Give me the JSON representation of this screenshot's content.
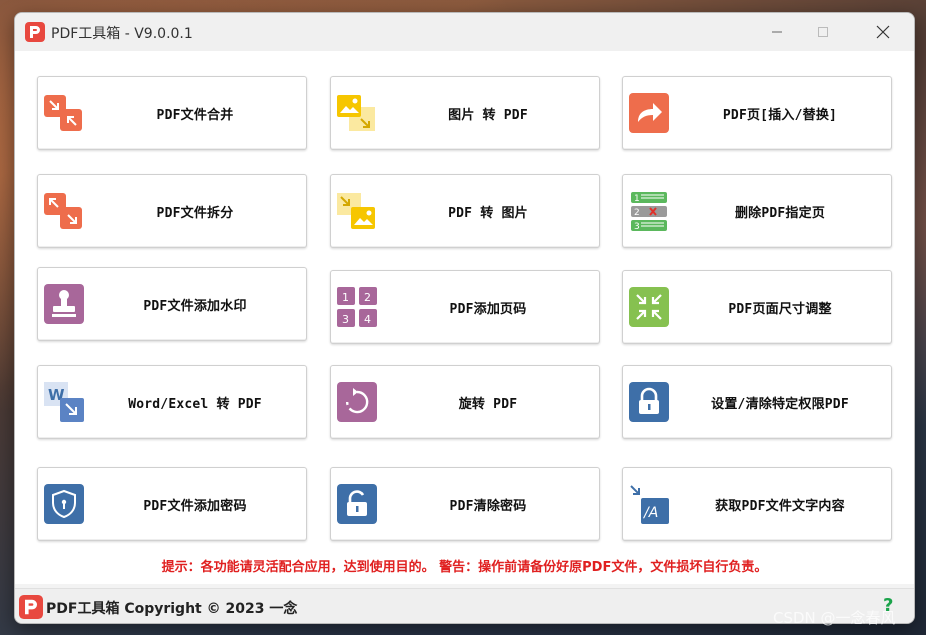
{
  "window": {
    "title": "PDF工具箱 - V9.0.0.1"
  },
  "tools": [
    {
      "label": "PDF文件合并",
      "icon": "merge-icon"
    },
    {
      "label": "图片 转 PDF",
      "icon": "image-to-pdf-icon"
    },
    {
      "label": "PDF页[插入/替换]",
      "icon": "share-arrow-icon"
    },
    {
      "label": "PDF文件拆分",
      "icon": "split-icon"
    },
    {
      "label": "PDF 转 图片",
      "icon": "pdf-to-image-icon"
    },
    {
      "label": "删除PDF指定页",
      "icon": "delete-page-list-icon"
    },
    {
      "label": "PDF文件添加水印",
      "icon": "stamp-icon"
    },
    {
      "label": "PDF添加页码",
      "icon": "page-number-grid-icon"
    },
    {
      "label": "PDF页面尺寸调整",
      "icon": "resize-compress-icon"
    },
    {
      "label": "Word/Excel 转 PDF",
      "icon": "word-to-pdf-icon"
    },
    {
      "label": "旋转 PDF",
      "icon": "rotate-icon"
    },
    {
      "label": "设置/清除特定权限PDF",
      "icon": "permission-lock-icon"
    },
    {
      "label": "PDF文件添加密码",
      "icon": "shield-icon"
    },
    {
      "label": "PDF清除密码",
      "icon": "unlock-icon"
    },
    {
      "label": "获取PDF文件文字内容",
      "icon": "extract-text-icon"
    }
  ],
  "hint": "提示：各功能请灵活配合应用，达到使用目的。 警告：操作前请备份好原PDF文件，文件损坏自行负责。",
  "footer": {
    "copyright": "PDF工具箱 Copyright © 2023 一念",
    "help": "?"
  },
  "watermark": "CSDN @一念春风",
  "colors": {
    "orange": "#ee6d4c",
    "yellow": "#f6c600",
    "purple": "#a8679a",
    "green": "#86c150",
    "blue": "#3e6fa8",
    "hint_red": "#e02020"
  }
}
